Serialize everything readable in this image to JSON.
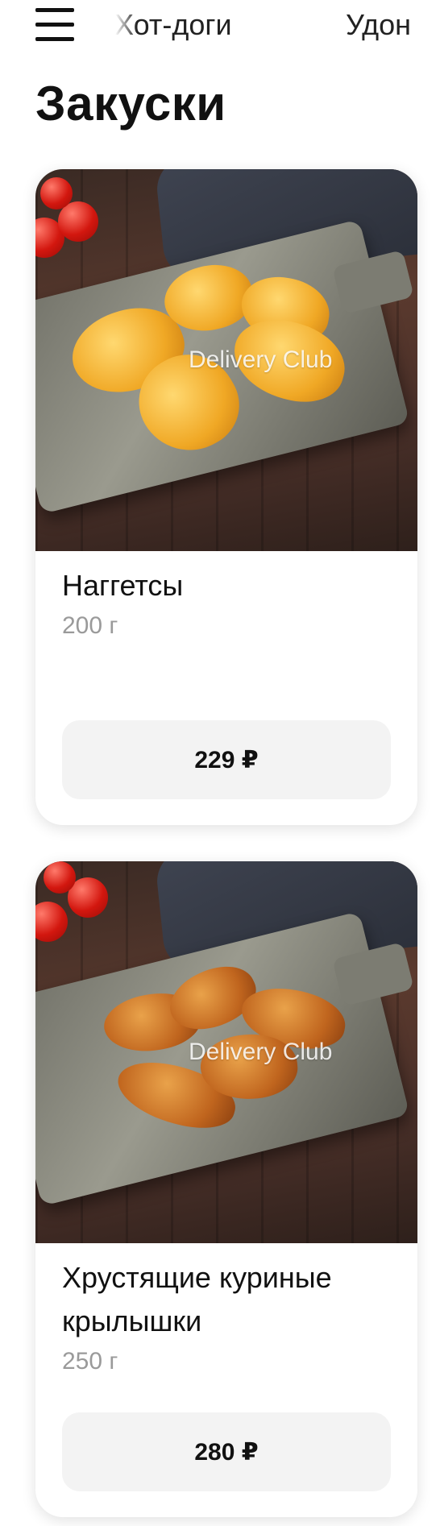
{
  "nav": {
    "tabs": [
      {
        "label": "Хот-доги"
      },
      {
        "label": "Удон"
      }
    ]
  },
  "section": {
    "title": "Закуски"
  },
  "products": [
    {
      "name": "Наггетсы",
      "weight": "200 г",
      "price": "229 ₽",
      "watermark": "Delivery Club"
    },
    {
      "name": "Хрустящие куриные крылышки",
      "weight": "250 г",
      "price": "280 ₽",
      "watermark": "Delivery Club"
    }
  ],
  "colors": {
    "text": "#111111",
    "muted": "#9a9a9a",
    "button_bg": "#f3f3f3",
    "card_bg": "#ffffff"
  }
}
